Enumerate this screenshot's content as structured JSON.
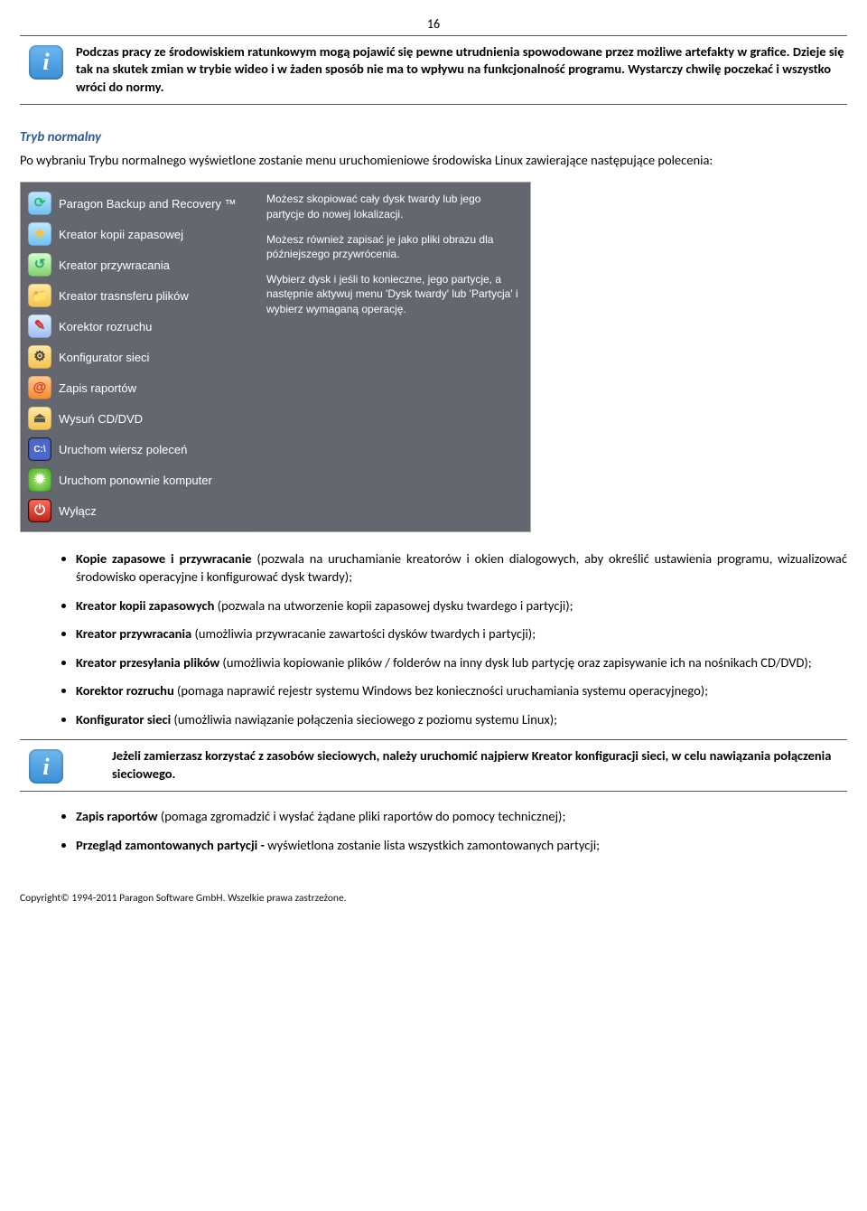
{
  "page_number": "16",
  "info_box_1": "Podczas pracy ze środowiskiem ratunkowym mogą pojawić się pewne utrudnienia spowodowane przez możliwe artefakty w grafice. Dzieje się tak na skutek zmian w trybie wideo i w żaden sposób nie ma to wpływu na funkcjonalność programu. Wystarczy chwilę poczekać i wszystko wróci do normy.",
  "section_title": "Tryb normalny",
  "intro_para": "Po wybraniu Trybu normalnego wyświetlone zostanie menu uruchomieniowe środowiska Linux zawierające następujące polecenia:",
  "menu": {
    "items": [
      {
        "label": "Paragon Backup and Recovery ™"
      },
      {
        "label": "Kreator kopii zapasowej"
      },
      {
        "label": "Kreator przywracania"
      },
      {
        "label": "Kreator trasnsferu plików"
      },
      {
        "label": "Korektor rozruchu"
      },
      {
        "label": "Konfigurator sieci"
      },
      {
        "label": "Zapis raportów"
      },
      {
        "label": "Wysuń CD/DVD"
      },
      {
        "label": "Uruchom wiersz poleceń"
      },
      {
        "label": "Uruchom ponownie komputer"
      },
      {
        "label": "Wyłącz"
      }
    ],
    "desc_p1": "Możesz skopiować cały dysk twardy lub jego partycje do nowej lokalizacji.",
    "desc_p2": "Możesz również zapisać je jako pliki obrazu dla późniejszego przywrócenia.",
    "desc_p3": "Wybierz dysk i jeśli to konieczne, jego partycje, a następnie aktywuj menu 'Dysk twardy' lub 'Partycja' i wybierz wymaganą operację."
  },
  "bullets1": [
    {
      "b": "Kopie zapasowe i przywracanie",
      "t": " (pozwala na uruchamianie kreatorów i okien dialogowych, aby określić ustawienia programu, wizualizować środowisko operacyjne i konfigurować dysk twardy);"
    },
    {
      "b": "Kreator kopii zapasowych",
      "t": " (pozwala na utworzenie kopii zapasowej dysku twardego i partycji);"
    },
    {
      "b": "Kreator przywracania",
      "t": " (umożliwia przywracanie zawartości dysków twardych i partycji);"
    },
    {
      "b": "Kreator przesyłania plików",
      "t": " (umożliwia kopiowanie plików / folderów na inny dysk lub partycję oraz zapisywanie ich na nośnikach CD/DVD);"
    },
    {
      "b": "Korektor rozruchu",
      "t": " (pomaga naprawić rejestr systemu Windows bez konieczności uruchamiania systemu operacyjnego);"
    },
    {
      "b": "Konfigurator sieci",
      "t": " (umożliwia nawiązanie połączenia sieciowego z poziomu systemu Linux);"
    }
  ],
  "info_box_2": "Jeżeli zamierzasz korzystać z zasobów sieciowych, należy uruchomić najpierw Kreator konfiguracji sieci, w celu nawiązania połączenia sieciowego.",
  "bullets2": [
    {
      "b": "Zapis raportów",
      "t": " (pomaga zgromadzić i wysłać żądane pliki raportów do pomocy technicznej);"
    },
    {
      "b": "Przegląd zamontowanych partycji - ",
      "t": "wyświetlona zostanie lista wszystkich zamontowanych partycji;"
    }
  ],
  "footer": "Copyright© 1994-2011 Paragon Software GmbH. Wszelkie prawa zastrzeżone."
}
